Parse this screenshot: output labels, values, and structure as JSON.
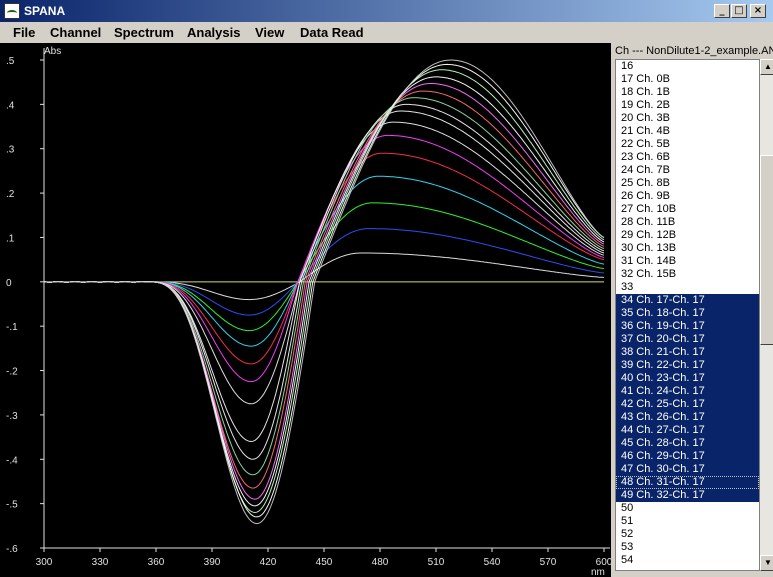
{
  "window": {
    "title": "SPANA",
    "icon": "spectrum-app-icon",
    "buttons": {
      "minimize": "_",
      "maximize": "□",
      "close": "×"
    }
  },
  "menu": [
    {
      "label": "File"
    },
    {
      "label": "Channel"
    },
    {
      "label": "Spectrum"
    },
    {
      "label": "Analysis"
    },
    {
      "label": "View"
    },
    {
      "label": "Data Read"
    }
  ],
  "list": {
    "header": "Ch --- NonDilute1-2_example.AN",
    "rows": [
      {
        "label": "16",
        "selected": false
      },
      {
        "label": "17 Ch. 0B",
        "selected": false
      },
      {
        "label": "18 Ch. 1B",
        "selected": false
      },
      {
        "label": "19 Ch. 2B",
        "selected": false
      },
      {
        "label": "20 Ch. 3B",
        "selected": false
      },
      {
        "label": "21 Ch. 4B",
        "selected": false
      },
      {
        "label": "22 Ch. 5B",
        "selected": false
      },
      {
        "label": "23 Ch. 6B",
        "selected": false
      },
      {
        "label": "24 Ch. 7B",
        "selected": false
      },
      {
        "label": "25 Ch. 8B",
        "selected": false
      },
      {
        "label": "26 Ch. 9B",
        "selected": false
      },
      {
        "label": "27 Ch. 10B",
        "selected": false
      },
      {
        "label": "28 Ch. 11B",
        "selected": false
      },
      {
        "label": "29 Ch. 12B",
        "selected": false
      },
      {
        "label": "30 Ch. 13B",
        "selected": false
      },
      {
        "label": "31 Ch. 14B",
        "selected": false
      },
      {
        "label": "32 Ch. 15B",
        "selected": false
      },
      {
        "label": "33",
        "selected": false
      },
      {
        "label": "34 Ch. 17-Ch. 17",
        "selected": true
      },
      {
        "label": "35 Ch. 18-Ch. 17",
        "selected": true
      },
      {
        "label": "36 Ch. 19-Ch. 17",
        "selected": true
      },
      {
        "label": "37 Ch. 20-Ch. 17",
        "selected": true
      },
      {
        "label": "38 Ch. 21-Ch. 17",
        "selected": true
      },
      {
        "label": "39 Ch. 22-Ch. 17",
        "selected": true
      },
      {
        "label": "40 Ch. 23-Ch. 17",
        "selected": true
      },
      {
        "label": "41 Ch. 24-Ch. 17",
        "selected": true
      },
      {
        "label": "42 Ch. 25-Ch. 17",
        "selected": true
      },
      {
        "label": "43 Ch. 26-Ch. 17",
        "selected": true
      },
      {
        "label": "44 Ch. 27-Ch. 17",
        "selected": true
      },
      {
        "label": "45 Ch. 28-Ch. 17",
        "selected": true
      },
      {
        "label": "46 Ch. 29-Ch. 17",
        "selected": true
      },
      {
        "label": "47 Ch. 30-Ch. 17",
        "selected": true
      },
      {
        "label": "48 Ch. 31-Ch. 17",
        "selected": true,
        "focused": true
      },
      {
        "label": "49 Ch. 32-Ch. 17",
        "selected": true
      },
      {
        "label": "50",
        "selected": false
      },
      {
        "label": "51",
        "selected": false
      },
      {
        "label": "52",
        "selected": false
      },
      {
        "label": "53",
        "selected": false
      },
      {
        "label": "54",
        "selected": false
      }
    ]
  },
  "chart_data": {
    "type": "line",
    "ylabel": "Abs",
    "xlabel": "nm",
    "xlim": [
      300,
      600
    ],
    "ylim": [
      -0.6,
      0.5
    ],
    "x_ticks": [
      300,
      330,
      360,
      390,
      420,
      450,
      480,
      510,
      540,
      570,
      600
    ],
    "y_ticks": [
      {
        "v": 0.5,
        "label": ".5"
      },
      {
        "v": 0.4,
        "label": ".4"
      },
      {
        "v": 0.3,
        "label": ".3"
      },
      {
        "v": 0.2,
        "label": ".2"
      },
      {
        "v": 0.1,
        "label": ".1"
      },
      {
        "v": 0,
        "label": "0"
      },
      {
        "v": -0.1,
        "label": "-.1"
      },
      {
        "v": -0.2,
        "label": "-.2"
      },
      {
        "v": -0.3,
        "label": "-.3"
      },
      {
        "v": -0.4,
        "label": "-.4"
      },
      {
        "v": -0.5,
        "label": "-.5"
      },
      {
        "v": -0.6,
        "label": "-.6"
      }
    ],
    "zero_line_color": "#d8d870",
    "grid": false,
    "series": [
      {
        "color": "#e8e8e8",
        "min": [
          410,
          -0.04
        ],
        "zero": 437,
        "max": [
          470,
          0.065
        ],
        "end": 0.01
      },
      {
        "color": "#3050ff",
        "min": [
          410,
          -0.075
        ],
        "zero": 436,
        "max": [
          474,
          0.12
        ],
        "end": 0.02
      },
      {
        "color": "#30ff30",
        "min": [
          410,
          -0.11
        ],
        "zero": 436,
        "max": [
          476,
          0.178
        ],
        "end": 0.03
      },
      {
        "color": "#30e0ff",
        "min": [
          411,
          -0.145
        ],
        "zero": 436,
        "max": [
          479,
          0.238
        ],
        "end": 0.04
      },
      {
        "color": "#ff3050",
        "min": [
          411,
          -0.185
        ],
        "zero": 436,
        "max": [
          481,
          0.29
        ],
        "end": 0.05
      },
      {
        "color": "#ff40ff",
        "min": [
          411,
          -0.225
        ],
        "zero": 436,
        "max": [
          484,
          0.33
        ],
        "end": 0.055
      },
      {
        "color": "#e8e8e8",
        "min": [
          411,
          -0.275
        ],
        "zero": 437,
        "max": [
          487,
          0.36
        ],
        "end": 0.06
      },
      {
        "color": "#f0f0f0",
        "min": [
          411,
          -0.36
        ],
        "zero": 437,
        "max": [
          491,
          0.385
        ],
        "end": 0.065
      },
      {
        "color": "#f0f0f0",
        "min": [
          412,
          -0.4
        ],
        "zero": 438,
        "max": [
          494,
          0.4
        ],
        "end": 0.07
      },
      {
        "color": "#90e0a0",
        "min": [
          412,
          -0.435
        ],
        "zero": 439,
        "max": [
          498,
          0.415
        ],
        "end": 0.075
      },
      {
        "color": "#ff7070",
        "min": [
          412,
          -0.465
        ],
        "zero": 440,
        "max": [
          503,
          0.43
        ],
        "end": 0.08
      },
      {
        "color": "#ff70ff",
        "min": [
          413,
          -0.49
        ],
        "zero": 441,
        "max": [
          507,
          0.447
        ],
        "end": 0.085
      },
      {
        "color": "#ffffff",
        "min": [
          413,
          -0.505
        ],
        "zero": 442,
        "max": [
          510,
          0.462
        ],
        "end": 0.09
      },
      {
        "color": "#c0ffc0",
        "min": [
          413,
          -0.52
        ],
        "zero": 443,
        "max": [
          513,
          0.478
        ],
        "end": 0.095
      },
      {
        "color": "#ffffff",
        "min": [
          414,
          -0.53
        ],
        "zero": 444,
        "max": [
          516,
          0.49
        ],
        "end": 0.1
      },
      {
        "color": "#c8c8c8",
        "min": [
          414,
          -0.545
        ],
        "zero": 445,
        "max": [
          518,
          0.5
        ],
        "end": 0.1
      }
    ]
  }
}
